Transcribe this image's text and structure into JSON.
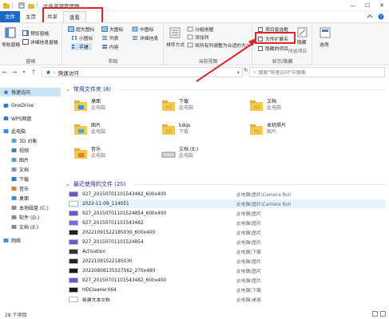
{
  "titlebar": {
    "title": "文件资源管理器",
    "minimize": "—",
    "maximize": "☐",
    "close": "✕"
  },
  "tabs": [
    {
      "label": "文件"
    },
    {
      "label": "主页"
    },
    {
      "label": "共享"
    },
    {
      "label": "查看"
    }
  ],
  "ribbon": {
    "pane_group": {
      "nav_pane": "导航窗格",
      "preview_pane": "预览窗格",
      "details_pane": "详细信息窗格",
      "label": "窗格"
    },
    "layout_group": {
      "items": [
        "超大图标",
        "大图标",
        "中图标",
        "小图标",
        "列表",
        "详细信息",
        "平铺",
        "内容"
      ],
      "label": "布局"
    },
    "sort": "排序方式",
    "current_view": {
      "group_by": "分组依据",
      "add_columns": "添加列",
      "fit_columns": "将所有列调整为合适的大小",
      "label": "当前视图"
    },
    "show_hide": {
      "item_checkboxes": "项目复选框",
      "file_extensions": "文件扩展名",
      "hidden_items": "隐藏的项目",
      "hide": "隐藏",
      "hide_selected": "所选项目",
      "label": "显示/隐藏"
    },
    "options": "选项"
  },
  "address": {
    "path": "快速访问",
    "search_placeholder": "搜索\"快速访问\"中搜索"
  },
  "nav": [
    {
      "label": "快速访问",
      "icon": "star-icon"
    },
    {
      "label": "OneDrive",
      "icon": "cloud-icon"
    },
    {
      "label": "WPS网盘",
      "icon": "cloud-icon"
    },
    {
      "label": "此电脑",
      "icon": "pc-icon"
    },
    {
      "label": "3D 对象",
      "icon": "cube-icon"
    },
    {
      "label": "视频",
      "icon": "video-icon"
    },
    {
      "label": "图片",
      "icon": "picture-icon"
    },
    {
      "label": "文档",
      "icon": "document-icon"
    },
    {
      "label": "下载",
      "icon": "download-icon"
    },
    {
      "label": "音乐",
      "icon": "music-icon"
    },
    {
      "label": "桌面",
      "icon": "desktop-icon"
    },
    {
      "label": "本地磁盘 (C:)",
      "icon": "drive-icon"
    },
    {
      "label": "软件 (D:)",
      "icon": "drive-icon"
    },
    {
      "label": "文档 (E:)",
      "icon": "drive-icon"
    },
    {
      "label": "网络",
      "icon": "network-icon"
    }
  ],
  "frequent": {
    "header": "常用文件夹 (8)",
    "items": [
      {
        "name": "桌面",
        "sub": "此电脑"
      },
      {
        "name": "下载",
        "sub": "此电脑"
      },
      {
        "name": "文档",
        "sub": "此电脑"
      },
      {
        "name": "图片",
        "sub": "此电脑"
      },
      {
        "name": "kdqs",
        "sub": "下载"
      },
      {
        "name": "本机照片",
        "sub": "图片"
      },
      {
        "name": "音乐",
        "sub": "此电脑"
      },
      {
        "name": "文档 (E:)",
        "sub": "此电脑"
      }
    ]
  },
  "recent": {
    "header": "最近使用的文件 (20)",
    "files": [
      {
        "name": "927_20150701101543482_600x400",
        "loc": "此电脑\\图片\\Camera Roll"
      },
      {
        "name": "2022-11-09_114051",
        "loc": "此电脑\\图片\\Camera Roll"
      },
      {
        "name": "927_20150701101524854_600x400",
        "loc": "此电脑\\图片"
      },
      {
        "name": "927_20150701101543482",
        "loc": "此电脑\\图片"
      },
      {
        "name": "20221091522185030_600x400",
        "loc": "此电脑\\图片"
      },
      {
        "name": "927_20150701101524854",
        "loc": "此电脑\\图片"
      },
      {
        "name": "Activation",
        "loc": "此电脑\\下载"
      },
      {
        "name": "20221091522185030",
        "loc": "此电脑\\图片"
      },
      {
        "name": "20220808135537562_270x480",
        "loc": "此电脑\\图片"
      },
      {
        "name": "927_20150701101543482_600x400",
        "loc": "此电脑\\图片"
      },
      {
        "name": "HDCleanerX64",
        "loc": "此电脑\\下载"
      },
      {
        "name": "新建文本文档",
        "loc": "此电脑\\桌面"
      }
    ]
  },
  "status": {
    "count": "28 个项目"
  }
}
